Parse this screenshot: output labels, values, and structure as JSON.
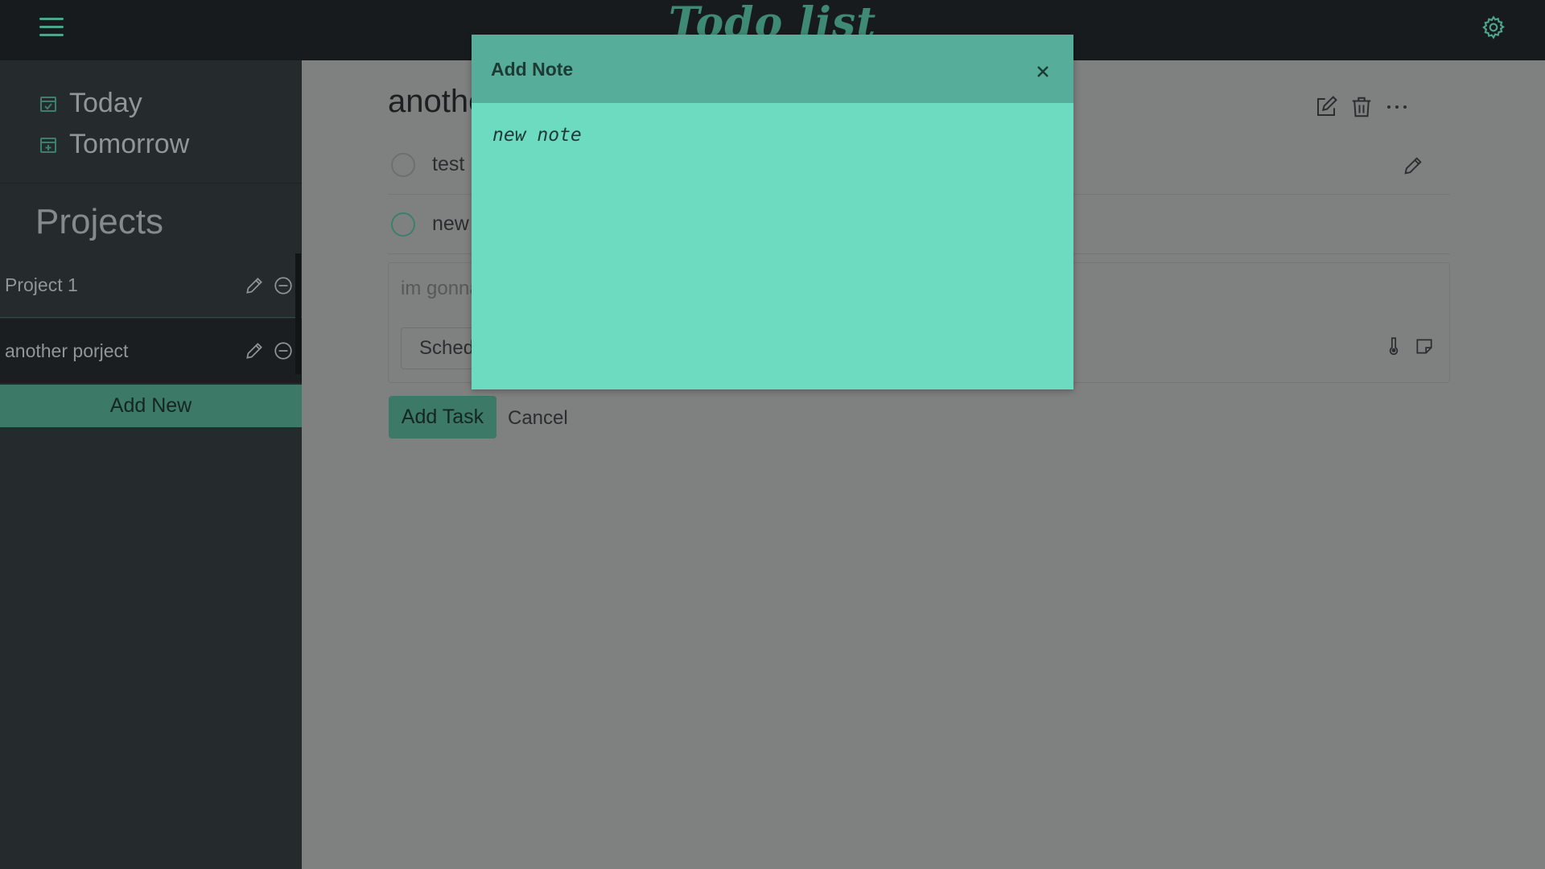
{
  "header": {
    "title": "Todo list"
  },
  "sidebar": {
    "nav": [
      {
        "label": "Today",
        "icon": "calendar-check-icon"
      },
      {
        "label": "Tomorrow",
        "icon": "calendar-plus-icon"
      }
    ],
    "projects_heading": "Projects",
    "projects": [
      {
        "name": "Project 1"
      },
      {
        "name": "another porject",
        "selected": true
      }
    ],
    "add_new_label": "Add New"
  },
  "main": {
    "project_title": "another porject",
    "tasks": [
      {
        "name": "test"
      },
      {
        "name": "new"
      }
    ],
    "new_task": {
      "text": "im gonna",
      "schedule_label": "Schedule"
    },
    "add_task_label": "Add Task",
    "cancel_label": "Cancel"
  },
  "modal": {
    "title": "Add Note",
    "note_value": "new note"
  },
  "colors": {
    "accent": "#3c7967",
    "topbar": "#171b1d",
    "sidebar": "#252a2c",
    "overlay": "#7f8180",
    "modal_body": "#6cdbc0",
    "modal_header": "#56ad99"
  }
}
